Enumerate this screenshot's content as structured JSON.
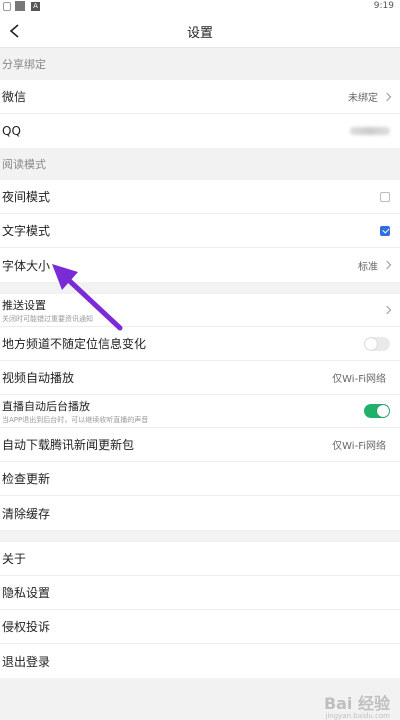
{
  "status_bar": {
    "time": "9:19",
    "icon3_label": "A"
  },
  "navbar": {
    "title": "设置"
  },
  "sections": {
    "share": {
      "header": "分享绑定",
      "wechat": {
        "label": "微信",
        "value": "未绑定"
      },
      "qq": {
        "label": "QQ"
      }
    },
    "reading": {
      "header": "阅读模式",
      "night": {
        "label": "夜间模式",
        "checked": false
      },
      "text_mode": {
        "label": "文字模式",
        "checked": true
      },
      "font_size": {
        "label": "字体大小",
        "value": "标准"
      }
    },
    "general": {
      "push": {
        "label": "推送设置",
        "sub": "关闭时可能错过重要资讯通知"
      },
      "location": {
        "label": "地方频道不随定位信息变化",
        "on": false
      },
      "video_autoplay": {
        "label": "视频自动播放",
        "value": "仅Wi-Fi网络"
      },
      "live_bg": {
        "label": "直播自动后台播放",
        "sub": "当APP退出到后台时，可以继续收听直播的声音",
        "on": true
      },
      "auto_download": {
        "label": "自动下载腾讯新闻更新包",
        "value": "仅Wi-Fi网络"
      },
      "check_update": {
        "label": "检查更新"
      },
      "clear_cache": {
        "label": "清除缓存"
      }
    },
    "about": {
      "about": {
        "label": "关于"
      },
      "privacy": {
        "label": "隐私设置"
      },
      "infringement": {
        "label": "侵权投诉"
      },
      "logout": {
        "label": "退出登录"
      }
    }
  },
  "watermark": {
    "text": "Bai 经验",
    "sub": "jingyan.baidu.com"
  },
  "colors": {
    "accent_blue": "#2f6fe0",
    "toggle_green": "#21b06a",
    "arrow_purple": "#7a2bd6"
  }
}
